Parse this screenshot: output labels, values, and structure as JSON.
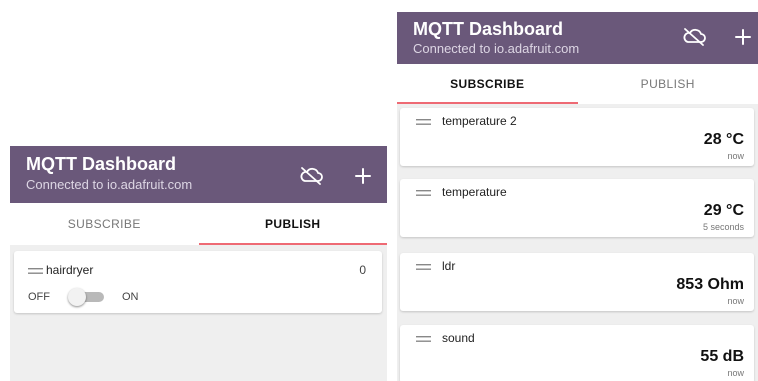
{
  "app": {
    "title": "MQTT Dashboard",
    "subtitle": "Connected to io.adafruit.com"
  },
  "icons": {
    "cloud": "cloud-off-icon",
    "add": "plus-icon",
    "drag": "drag-handle-icon"
  },
  "colors": {
    "appbar": "#6a587a",
    "tab_indicator": "#ee6a74",
    "background": "#efefef"
  },
  "tabs": {
    "subscribe": "SUBSCRIBE",
    "publish": "PUBLISH"
  },
  "publish_screen": {
    "active_tab": "publish",
    "items": [
      {
        "name": "hairdryer",
        "value": "0",
        "off_label": "OFF",
        "on_label": "ON",
        "switch_on": false
      }
    ]
  },
  "subscribe_screen": {
    "active_tab": "subscribe",
    "items": [
      {
        "name": "temperature 2",
        "value": "28 °C",
        "time": "now"
      },
      {
        "name": "temperature",
        "value": "29 °C",
        "time": "5 seconds"
      },
      {
        "name": "ldr",
        "value": "853 Ohm",
        "time": "now"
      },
      {
        "name": "sound",
        "value": "55 dB",
        "time": "now"
      }
    ]
  }
}
